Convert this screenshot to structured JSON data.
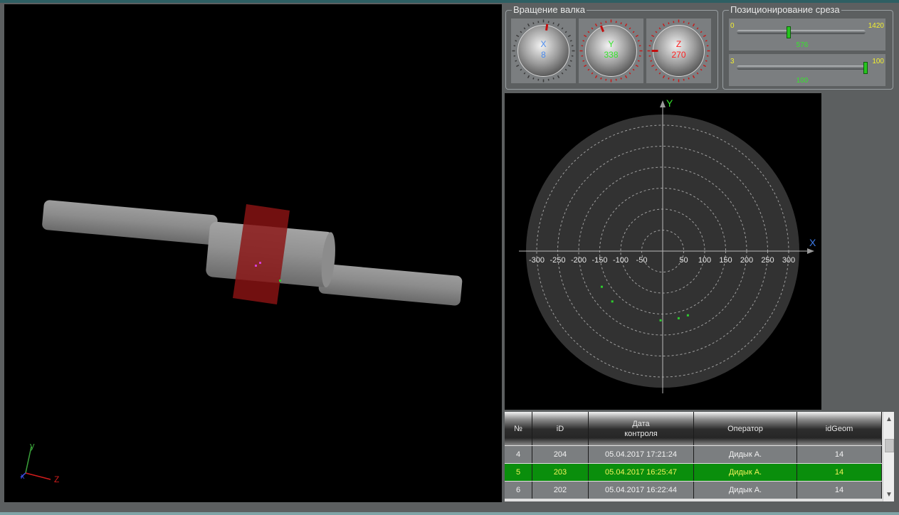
{
  "rotation_panel": {
    "title": "Вращение валка",
    "dials": [
      {
        "axis": "X",
        "value": "8",
        "color": "#4a8cf0"
      },
      {
        "axis": "Y",
        "value": "338",
        "color": "#36e52c"
      },
      {
        "axis": "Z",
        "value": "270",
        "color": "#ff2020"
      }
    ]
  },
  "section_panel": {
    "title": "Позиционирование среза",
    "sliders": [
      {
        "min": "0",
        "max": "1420",
        "value": "576",
        "fraction": 0.4056
      },
      {
        "min": "3",
        "max": "100",
        "value": "100",
        "fraction": 1.0
      }
    ]
  },
  "viewport_3d": {
    "axis_labels": {
      "x": "x",
      "y": "y",
      "z": "Z"
    }
  },
  "polar_plot": {
    "x_label": "X",
    "y_label": "Y",
    "x_ticks": [
      "-300",
      "-250",
      "-200",
      "-150",
      "-100",
      "-50",
      "50",
      "100",
      "150",
      "200",
      "250",
      "300"
    ],
    "points": [
      {
        "x": -145,
        "y": -85
      },
      {
        "x": -120,
        "y": -120
      },
      {
        "x": -5,
        "y": -165
      },
      {
        "x": 38,
        "y": -160
      },
      {
        "x": 60,
        "y": -153
      }
    ],
    "point_color": "#2ecc2e"
  },
  "table": {
    "columns": [
      "№",
      "iD",
      "Дата контроля",
      "Оператор",
      "idGeom"
    ],
    "rows": [
      {
        "n": "4",
        "id": "204",
        "date": "05.04.2017 17:21:24",
        "operator": "Дидык А.",
        "geom": "14",
        "selected": false
      },
      {
        "n": "5",
        "id": "203",
        "date": "05.04.2017 16:25:47",
        "operator": "Дидык А.",
        "geom": "14",
        "selected": true
      },
      {
        "n": "6",
        "id": "202",
        "date": "05.04.2017 16:22:44",
        "operator": "Дидык А.",
        "geom": "14",
        "selected": false
      }
    ],
    "scroll": {
      "up": "▲",
      "down": "▼"
    }
  }
}
